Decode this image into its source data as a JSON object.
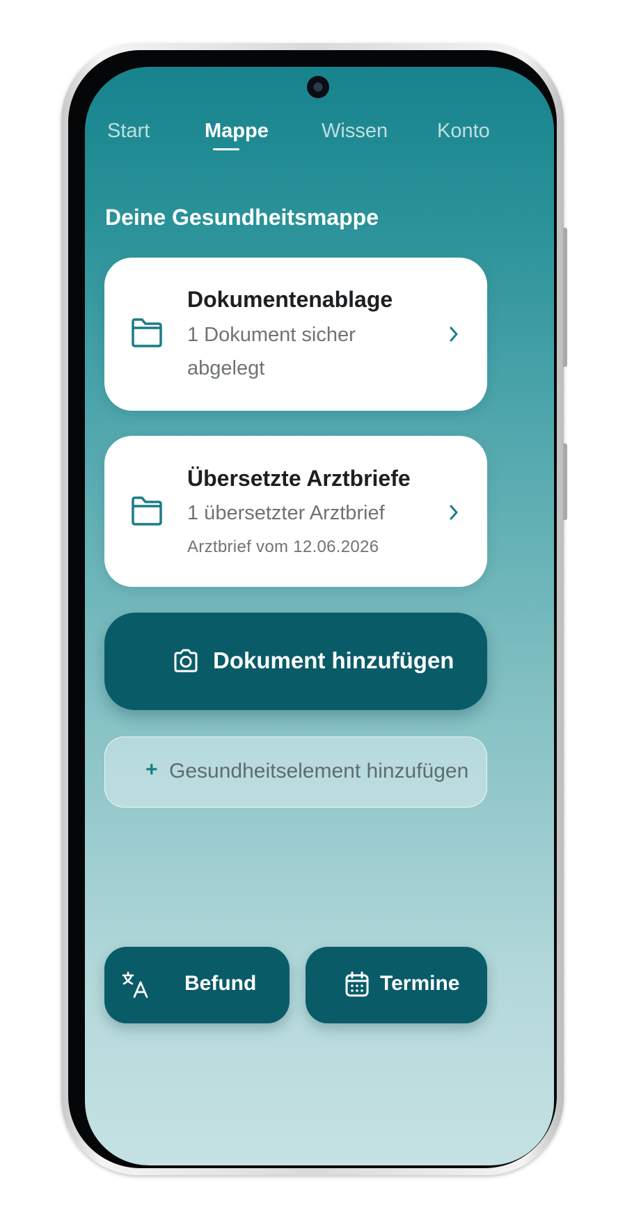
{
  "tabs": [
    {
      "label": "Start",
      "active": false
    },
    {
      "label": "Mappe",
      "active": true
    },
    {
      "label": "Wissen",
      "active": false
    },
    {
      "label": "Konto",
      "active": false
    }
  ],
  "section_title": "Deine Gesundheitsmappe",
  "cards": [
    {
      "title": "Dokumentenablage",
      "subtitle": "1 Dokument sicher abgelegt",
      "meta": "",
      "icon": "folder-icon"
    },
    {
      "title": "Übersetzte Arztbriefe",
      "subtitle": "1 übersetzter Arztbrief",
      "meta": "Arztbrief vom 12.06.2026",
      "icon": "folder-icon"
    }
  ],
  "primary_action": {
    "label": "Dokument hinzufügen",
    "icon": "camera-icon"
  },
  "secondary_action": {
    "label": "Gesundheitselement hinzufügen",
    "icon": "plus-icon",
    "icon_text": "+"
  },
  "bottom_actions": [
    {
      "label": "Befund",
      "icon": "translate-icon"
    },
    {
      "label": "Termine",
      "icon": "calendar-icon"
    }
  ],
  "colors": {
    "accent": "#0a5b68",
    "icon_teal": "#1b7c86",
    "gradient_top": "#17838d",
    "gradient_bottom": "#c5e1e3"
  }
}
